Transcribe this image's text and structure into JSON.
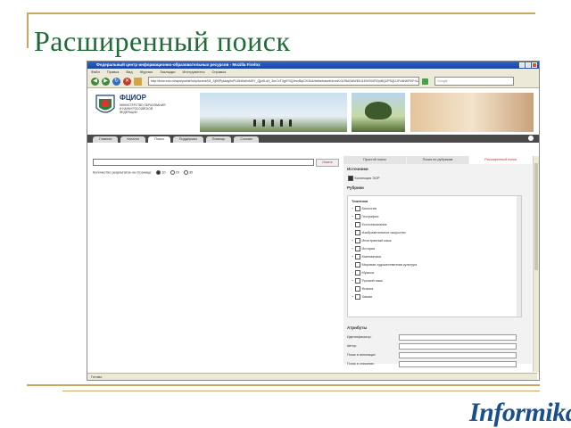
{
  "slide": {
    "title": "Расширенный поиск",
    "logo_text": "Informika"
  },
  "browser": {
    "window_title": "Федеральный центр информационно-образовательных ресурсов - Mozilla Firefox",
    "menu": [
      "Файл",
      "Правка",
      "Вид",
      "Журнал",
      "Закладки",
      "Инструменты",
      "Справка"
    ],
    "url": "http://fcior.edu.ru/wps/portal/!ut/p/kcxml/04_Sj9SPykssy0xPLMnMz0vM0Y_QjzKLd4_3mCvT3gfYSQJrsxBqCXOkA/delta/base64xml/L0lJSk03dWlDU1EhIS9JRGpBQUF5QUJFUkNKRXFnLzRGR2dkWW5LSjBGUm9YZmcvN19LMw!!",
    "search_placeholder": "Google",
    "status": "Готово"
  },
  "site": {
    "name": "ФЦИОР",
    "subtitle": "МИНИСТЕРСТВО ОБРАЗОВАНИЯ И НАУКИ РОССИЙСКОЙ ФЕДЕРАЦИИ",
    "nav_tabs": [
      "Главная",
      "Каталог",
      "Поиск",
      "Поддержка",
      "Помощь",
      "Ссылки"
    ],
    "active_tab": "Поиск"
  },
  "search": {
    "find_label": "Искать",
    "results_per_page_label": "Количество результатов на странице:",
    "per_page_options": [
      "10",
      "20",
      "30"
    ],
    "per_page_selected": "10"
  },
  "panel": {
    "tabs": [
      "Простой поиск",
      "Поиск по рубрикам",
      "Расширенный поиск"
    ],
    "active_tab": "Расширенный поиск",
    "sources_title": "Источники",
    "sources_item": "Коллекция ЭОР",
    "rubrics_title": "Рубрики",
    "topics_title": "Тематика",
    "topics": [
      {
        "mark": "+",
        "label": "Биология"
      },
      {
        "mark": "+",
        "label": "География"
      },
      {
        "mark": "·",
        "label": "Естествознание"
      },
      {
        "mark": "·",
        "label": "Изобразительное искусство"
      },
      {
        "mark": "+",
        "label": "Иностранный язык"
      },
      {
        "mark": "+",
        "label": "История"
      },
      {
        "mark": "+",
        "label": "Математика"
      },
      {
        "mark": "·",
        "label": "Мировая художественная культура"
      },
      {
        "mark": "·",
        "label": "Музыка"
      },
      {
        "mark": "+",
        "label": "Русский язык"
      },
      {
        "mark": "·",
        "label": "Физика"
      },
      {
        "mark": "+",
        "label": "Химия"
      }
    ],
    "attributes_title": "Атрибуты",
    "attributes": [
      "Идентификатор:",
      "Автор:",
      "Поиск в аннотации:",
      "Поиск в описании:"
    ]
  },
  "colors": {
    "title_green": "#1e6b36",
    "rule_gold": "#c8a860",
    "logo_blue": "#1a4f8e",
    "active_red": "#c03030"
  }
}
